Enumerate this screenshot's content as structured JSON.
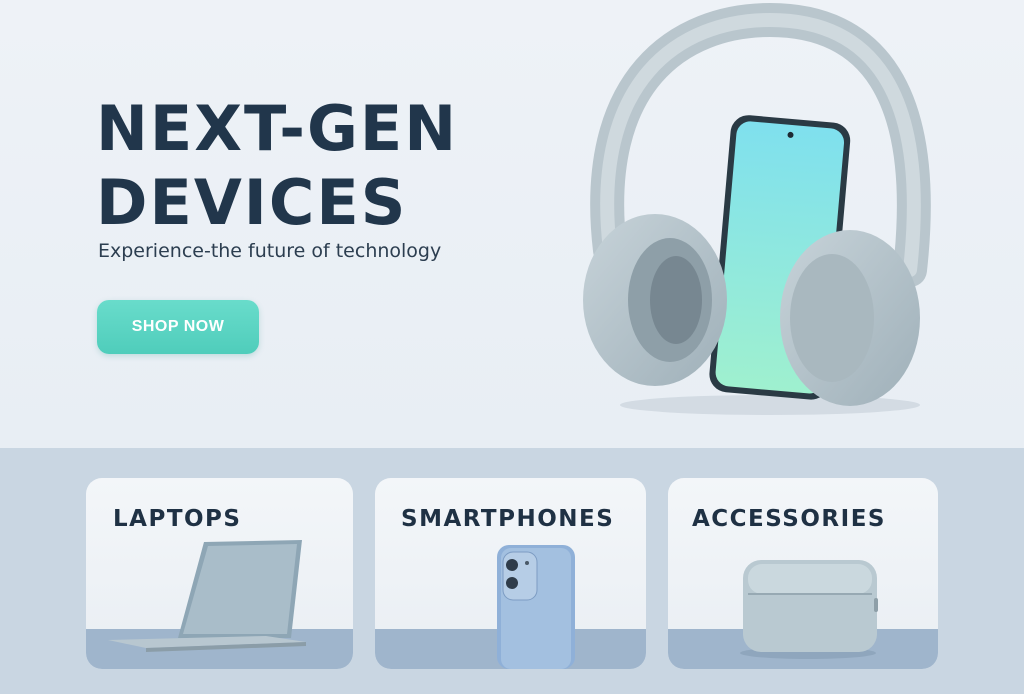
{
  "hero": {
    "title_line1": "NEXT-GEN",
    "title_line2": "DEVICES",
    "subtitle": "Experience-the future of technology",
    "cta_label": "SHOP NOW"
  },
  "categories": [
    {
      "label": "LAPTOPS",
      "icon": "laptop-icon"
    },
    {
      "label": "SMARTPHONES",
      "icon": "smartphone-icon"
    },
    {
      "label": "ACCESSORIES",
      "icon": "earbuds-case-icon"
    }
  ],
  "colors": {
    "heading": "#21364b",
    "accent": "#4fcdbb",
    "band": "#c9d6e2",
    "card_floor": "#9fb5cc"
  }
}
